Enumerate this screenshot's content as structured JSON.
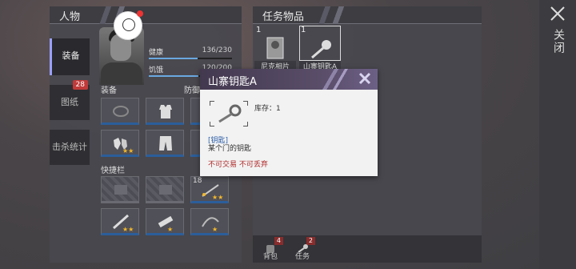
{
  "window": {
    "close_label": "关闭"
  },
  "left_panel": {
    "title": "人物",
    "tabs": [
      {
        "label": "装备",
        "active": true,
        "badge": ""
      },
      {
        "label": "图纸",
        "active": false,
        "badge": "28"
      },
      {
        "label": "击杀统计",
        "active": false,
        "badge": ""
      }
    ],
    "stats": [
      {
        "label": "健康",
        "value": "136/230",
        "fraction": 0.59
      },
      {
        "label": "饥饿",
        "value": "120/200",
        "fraction": 0.6
      }
    ],
    "equipment_label": "装备",
    "defense_label": "防御",
    "quickbar_label": "快捷栏",
    "equipment_slots": [
      {
        "icon": "ring-icon",
        "stars": ""
      },
      {
        "icon": "armor-vest-icon",
        "stars": ""
      },
      {
        "icon": "empty",
        "stars": ""
      },
      {
        "icon": "gloves-icon",
        "stars": "★★"
      },
      {
        "icon": "pants-icon",
        "stars": ""
      },
      {
        "icon": "empty",
        "stars": ""
      }
    ],
    "quick_slots": [
      {
        "icon": "empty-slot-icon",
        "qty": "",
        "stars": ""
      },
      {
        "icon": "empty-slot-icon",
        "qty": "",
        "stars": ""
      },
      {
        "icon": "crossbow-icon",
        "qty": "18",
        "stars": "★★"
      },
      {
        "icon": "knife-icon",
        "qty": "",
        "stars": "★★"
      },
      {
        "icon": "bandage-icon",
        "qty": "",
        "stars": "★"
      },
      {
        "icon": "bow-icon",
        "qty": "",
        "stars": "★"
      }
    ]
  },
  "right_panel": {
    "title": "任务物品",
    "items": [
      {
        "count": "1",
        "name": "尼克相片",
        "icon": "photo-icon",
        "selected": false
      },
      {
        "count": "1",
        "name": "山寨钥匙A",
        "icon": "key-icon",
        "selected": true
      }
    ],
    "bottom_tabs": [
      {
        "label": "背包",
        "badge": "4",
        "icon": "backpack-icon"
      },
      {
        "label": "任务",
        "badge": "2",
        "icon": "key-icon"
      }
    ]
  },
  "popup": {
    "title": "山寨钥匙A",
    "stock": "库存：1",
    "type": "[钥匙]",
    "description": "某个门的钥匙",
    "restriction": "不可交易 不可丢弃"
  },
  "colors": {
    "accent_blue": "#2b5e9a",
    "star_gold": "#f3b82a",
    "restriction_red": "#b02a2a",
    "type_blue": "#2d5ea8"
  }
}
